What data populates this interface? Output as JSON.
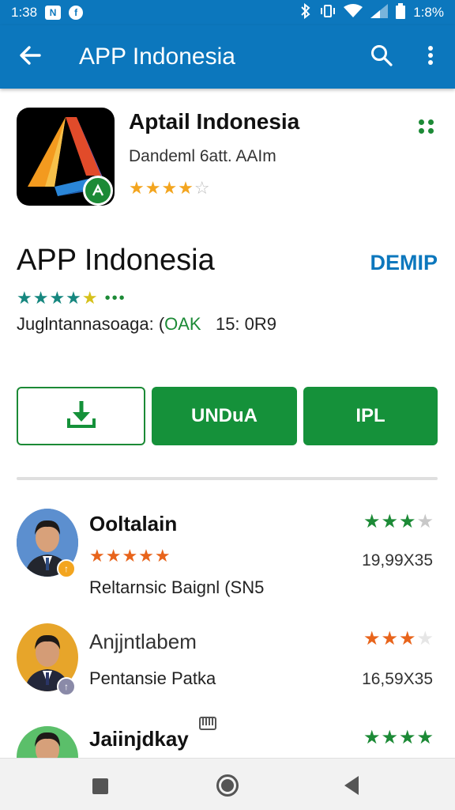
{
  "status_bar": {
    "time": "1:38",
    "notification_badge": "N",
    "battery_text": "1:8%"
  },
  "app_bar": {
    "title": "APP Indonesia",
    "icons": [
      "arrow-back-icon",
      "search-icon",
      "more-vert-icon"
    ]
  },
  "app_header": {
    "name": "Aptail Indonesia",
    "developer": "Dandeml 6att. AAIm",
    "rating_stars": "★★★★☆",
    "logo_icon": "triangle-logo-icon",
    "badge_icon": "verified-badge-icon"
  },
  "details": {
    "title": "APP Indonesia",
    "action_link": "DEMIP",
    "rating_stars": "★★★★★",
    "rating_more": "•••",
    "meta_prefix": "Juglntannasoaga: (",
    "meta_highlight": "OAK",
    "meta_suffix": "15: 0R9"
  },
  "buttons": {
    "download_icon": "download-icon",
    "undua_label": "UNDuA",
    "ipl_label": "IPL"
  },
  "reviews": [
    {
      "name": "Ooltalain",
      "stars_left": "★★★★★",
      "subtitle": "Reltarnsic Baignl (SN5",
      "stars_right": "★★★★",
      "stars_right_filled": 3,
      "size": "19,99X35"
    },
    {
      "name": "Anjjntlabem",
      "subtitle": "Pentansie Patka",
      "stars_right": "★★★★",
      "stars_right_filled": 3,
      "size": "16,59X35"
    },
    {
      "name": "Jaiinjdkay",
      "stars_right": "★★★★",
      "stars_right_filled": 4
    }
  ],
  "colors": {
    "primary_blue": "#0c77bd",
    "primary_green": "#15913a",
    "star_orange": "#e8641b",
    "star_teal": "#16877f",
    "star_gold": "#f3a51f"
  }
}
